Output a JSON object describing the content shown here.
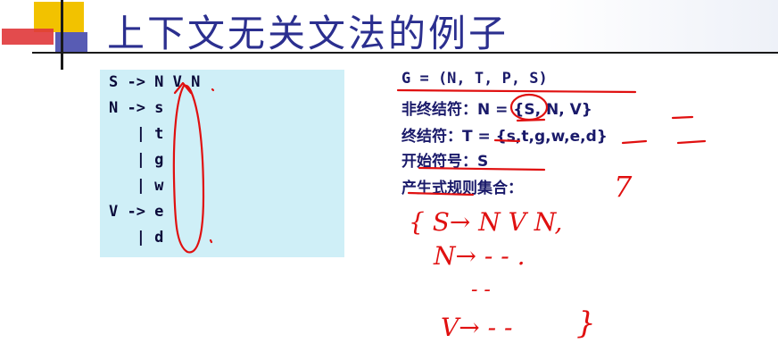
{
  "slide": {
    "title": "上下文无关文法的例子"
  },
  "grammar": {
    "lines": [
      "S -> N V N",
      "N -> s",
      "   | t",
      "   | g",
      "   | w",
      "V -> e",
      "   | d"
    ]
  },
  "definition": {
    "tuple": "G = (N, T, P, S)",
    "nonterminals": "非终结符：N = {S, N, V}",
    "terminals": "终结符：T = {s,t,g,w,e,d}",
    "start": "开始符号：S",
    "rules": "产生式规则集合："
  },
  "handwriting": {
    "notes": [
      "7",
      "{ S→ N V N,",
      "N→ - - .",
      "- -",
      "V→ - -",
      "}"
    ]
  },
  "colors": {
    "title": "#2b2f8f",
    "ink": "#e01010",
    "box": "#cfeff7"
  }
}
